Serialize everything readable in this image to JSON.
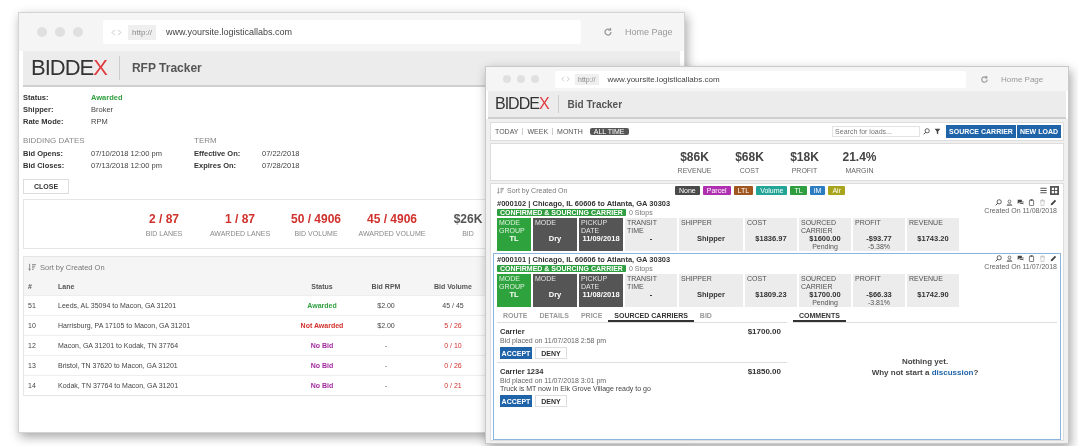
{
  "rfp_window": {
    "browser": {
      "protocol": "http://",
      "url": "www.yoursite.logisticallabs.com",
      "home": "Home Page"
    },
    "logo": "BIDDEX",
    "title": "RFP Tracker",
    "details": [
      {
        "label": "Status:",
        "value": "Awarded",
        "kind": "awarded"
      },
      {
        "label": "Shipper:",
        "value": "Broker",
        "kind": "plain"
      },
      {
        "label": "Rate Mode:",
        "value": "RPM",
        "kind": "plain"
      }
    ],
    "bidding_dates": {
      "heading": "BIDDING DATES",
      "rows": [
        {
          "label": "Bid Opens:",
          "value": "07/10/2018 12:00 pm"
        },
        {
          "label": "Bid Closes:",
          "value": "07/13/2018 12:00 pm"
        }
      ]
    },
    "term": {
      "heading": "TERM",
      "rows": [
        {
          "label": "Effective On:",
          "value": "07/22/2018"
        },
        {
          "label": "Expires On:",
          "value": "07/28/2018"
        }
      ]
    },
    "close_button": "CLOSE",
    "stats": [
      {
        "value": "2 / 87",
        "label": "BID LANES",
        "kind": "ratio"
      },
      {
        "value": "1 / 87",
        "label": "AWARDED LANES",
        "kind": "ratio"
      },
      {
        "value": "50 / 4906",
        "label": "BID VOLUME",
        "kind": "ratio"
      },
      {
        "value": "45 / 4906",
        "label": "AWARDED VOLUME",
        "kind": "ratio"
      },
      {
        "value": "$26K",
        "label": "BID",
        "kind": "amount"
      }
    ],
    "sort_label": "Sort by Created On",
    "table": {
      "columns": [
        "#",
        "Lane",
        "Status",
        "Bid RPM",
        "Bid Volume"
      ],
      "rows": [
        {
          "number": "51",
          "lane": "Leeds, AL 35094 to Macon, GA 31201",
          "status": "Awarded",
          "kind": "awarded",
          "bid_rpm": "$2.00",
          "bid_volume": "45 / 45",
          "volume_met": true
        },
        {
          "number": "10",
          "lane": "Harrisburg, PA 17105 to Macon, GA 31201",
          "status": "Not Awarded",
          "kind": "not_awarded",
          "bid_rpm": "$2.00",
          "bid_volume": "5 / 26",
          "volume_met": false
        },
        {
          "number": "12",
          "lane": "Macon, GA 31201 to Kodak, TN 37764",
          "status": "No Bid",
          "kind": "no_bid",
          "bid_rpm": "-",
          "bid_volume": "0 / 10",
          "volume_met": false
        },
        {
          "number": "13",
          "lane": "Bristol, TN 37620 to Macon, GA 31201",
          "status": "No Bid",
          "kind": "no_bid",
          "bid_rpm": "-",
          "bid_volume": "0 / 26",
          "volume_met": false
        },
        {
          "number": "14",
          "lane": "Kodak, TN 37764 to Macon, GA 31201",
          "status": "No Bid",
          "kind": "no_bid",
          "bid_rpm": "-",
          "bid_volume": "0 / 21",
          "volume_met": false
        }
      ]
    }
  },
  "bid_window": {
    "browser": {
      "protocol": "http://",
      "url": "www.yoursite.logisticallabs.com",
      "home": "Home Page"
    },
    "logo": "BIDDEX",
    "title": "Bid Tracker",
    "ranges": [
      {
        "label": "TODAY",
        "selected": false
      },
      {
        "label": "WEEK",
        "selected": false
      },
      {
        "label": "MONTH",
        "selected": false
      },
      {
        "label": "ALL TIME",
        "selected": true
      }
    ],
    "search": {
      "placeholder": "Search for loads..."
    },
    "buttons": [
      "SOURCE CARRIER",
      "NEW LOAD"
    ],
    "stats": [
      {
        "value": "$86K",
        "label": "REVENUE"
      },
      {
        "value": "$68K",
        "label": "COST"
      },
      {
        "value": "$18K",
        "label": "PROFIT"
      },
      {
        "value": "21.4%",
        "label": "MARGIN"
      }
    ],
    "sort_label": "Sort by Created On",
    "mode_tags": [
      {
        "label": "None",
        "color": "#4a4a4a"
      },
      {
        "label": "Parcel",
        "color": "#b02fb0"
      },
      {
        "label": "LTL",
        "color": "#a0561f"
      },
      {
        "label": "Volume",
        "color": "#22a596"
      },
      {
        "label": "TL",
        "color": "#2e9e3e"
      },
      {
        "label": "IM",
        "color": "#2c7cc1"
      },
      {
        "label": "Air",
        "color": "#a8a51c"
      }
    ],
    "views": [
      {
        "kind": "list",
        "selected": false
      },
      {
        "kind": "grid",
        "selected": true
      }
    ],
    "loads": [
      {
        "title": "#000102 | Chicago, IL 60606 to Atlanta, GA 30303",
        "status": "CONFIRMED & SOURCING CARRIER",
        "stops": "0 Stops",
        "created": "Created On 11/08/2018",
        "expanded": false,
        "fields": [
          {
            "label": "MODE GROUP",
            "value": "TL",
            "kind": "mode"
          },
          {
            "label": "MODE",
            "value": "Dry",
            "kind": "dark"
          },
          {
            "label": "PICKUP DATE",
            "value": "11/09/2018",
            "kind": "dark"
          },
          {
            "label": "TRANSIT TIME",
            "value": "-",
            "kind": "plain"
          },
          {
            "label": "SHIPPER",
            "value": "Shipper",
            "kind": "wide"
          },
          {
            "label": "COST",
            "value": "$1836.97",
            "kind": "plain"
          },
          {
            "label": "SOURCED CARRIER",
            "value": "$1600.00",
            "sub": "Pending",
            "kind": "plain"
          },
          {
            "label": "PROFIT",
            "value": "-$93.77",
            "sub": "-5.38%",
            "kind": "plain"
          },
          {
            "label": "REVENUE",
            "value": "$1743.20",
            "kind": "plain"
          }
        ]
      },
      {
        "title": "#000101 | Chicago, IL 60606 to Atlanta, GA 30303",
        "status": "CONFIRMED & SOURCING CARRIER",
        "stops": "0 Stops",
        "created": "Created On 11/07/2018",
        "expanded": true,
        "fields": [
          {
            "label": "MODE GROUP",
            "value": "TL",
            "kind": "mode"
          },
          {
            "label": "MODE",
            "value": "Dry",
            "kind": "dark"
          },
          {
            "label": "PICKUP DATE",
            "value": "11/08/2018",
            "kind": "dark"
          },
          {
            "label": "TRANSIT TIME",
            "value": "-",
            "kind": "plain"
          },
          {
            "label": "SHIPPER",
            "value": "Shipper",
            "kind": "wide"
          },
          {
            "label": "COST",
            "value": "$1809.23",
            "kind": "plain"
          },
          {
            "label": "SOURCED CARRIER",
            "value": "$1700.00",
            "sub": "Pending",
            "kind": "plain"
          },
          {
            "label": "PROFIT",
            "value": "-$66.33",
            "sub": "-3.81%",
            "kind": "plain"
          },
          {
            "label": "REVENUE",
            "value": "$1742.90",
            "kind": "plain"
          }
        ]
      }
    ],
    "detail": {
      "tabs": [
        {
          "label": "ROUTE",
          "selected": false
        },
        {
          "label": "DETAILS",
          "selected": false
        },
        {
          "label": "PRICE",
          "selected": false
        },
        {
          "label": "SOURCED CARRIERS",
          "selected": true
        },
        {
          "label": "BID",
          "selected": false
        }
      ],
      "carriers": [
        {
          "name": "Carrier",
          "placed": "Bid placed on 11/07/2018 2:58 pm",
          "amount": "$1700.00",
          "accept": "ACCEPT",
          "deny": "DENY"
        },
        {
          "name": "Carrier 1234",
          "placed": "Bid placed on 11/07/2018 3:01 pm",
          "note": "Truck is MT now in Elk Grove Village ready to go",
          "amount": "$1850.00",
          "accept": "ACCEPT",
          "deny": "DENY"
        }
      ],
      "comments_tab": {
        "label": "COMMENTS",
        "selected": true
      },
      "empty_title": "Nothing yet.",
      "prompt_before": "Why not start a ",
      "prompt_link": "discussion",
      "prompt_after": "?"
    }
  }
}
